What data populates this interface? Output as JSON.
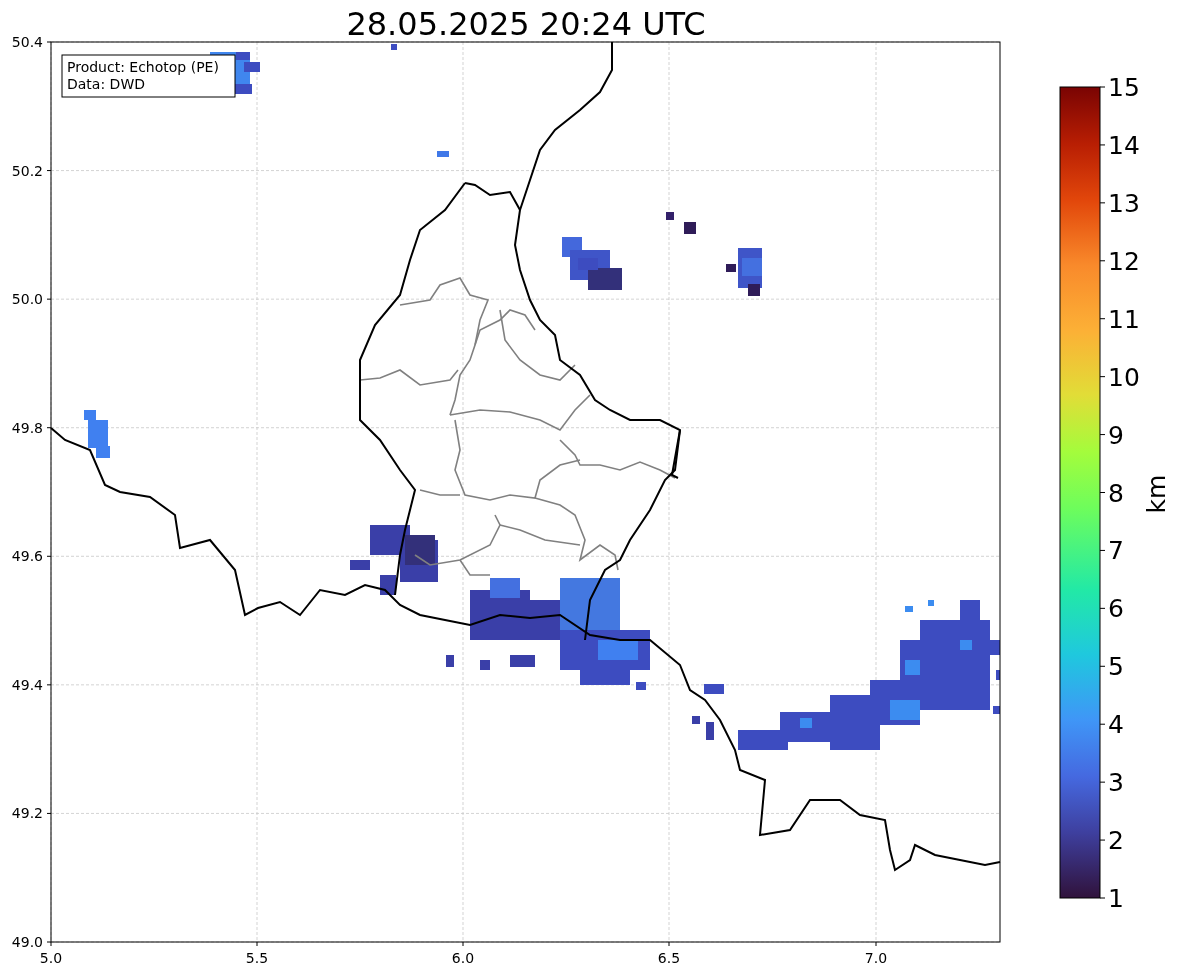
{
  "title": "28.05.2025 20:24 UTC",
  "info_box": [
    "Product: Echotop (PE)",
    "Data: DWD"
  ],
  "x_ticks": [
    "5.0",
    "5.5",
    "6.0",
    "6.5",
    "7.0"
  ],
  "y_ticks": [
    "50.4",
    "50.2",
    "50.0",
    "49.8",
    "49.6",
    "49.4",
    "49.2",
    "49.0"
  ],
  "colorbar": {
    "label": "km",
    "ticks": [
      "15",
      "14",
      "13",
      "12",
      "11",
      "10",
      "9",
      "8",
      "7",
      "6",
      "5",
      "4",
      "3",
      "2",
      "1"
    ]
  }
}
